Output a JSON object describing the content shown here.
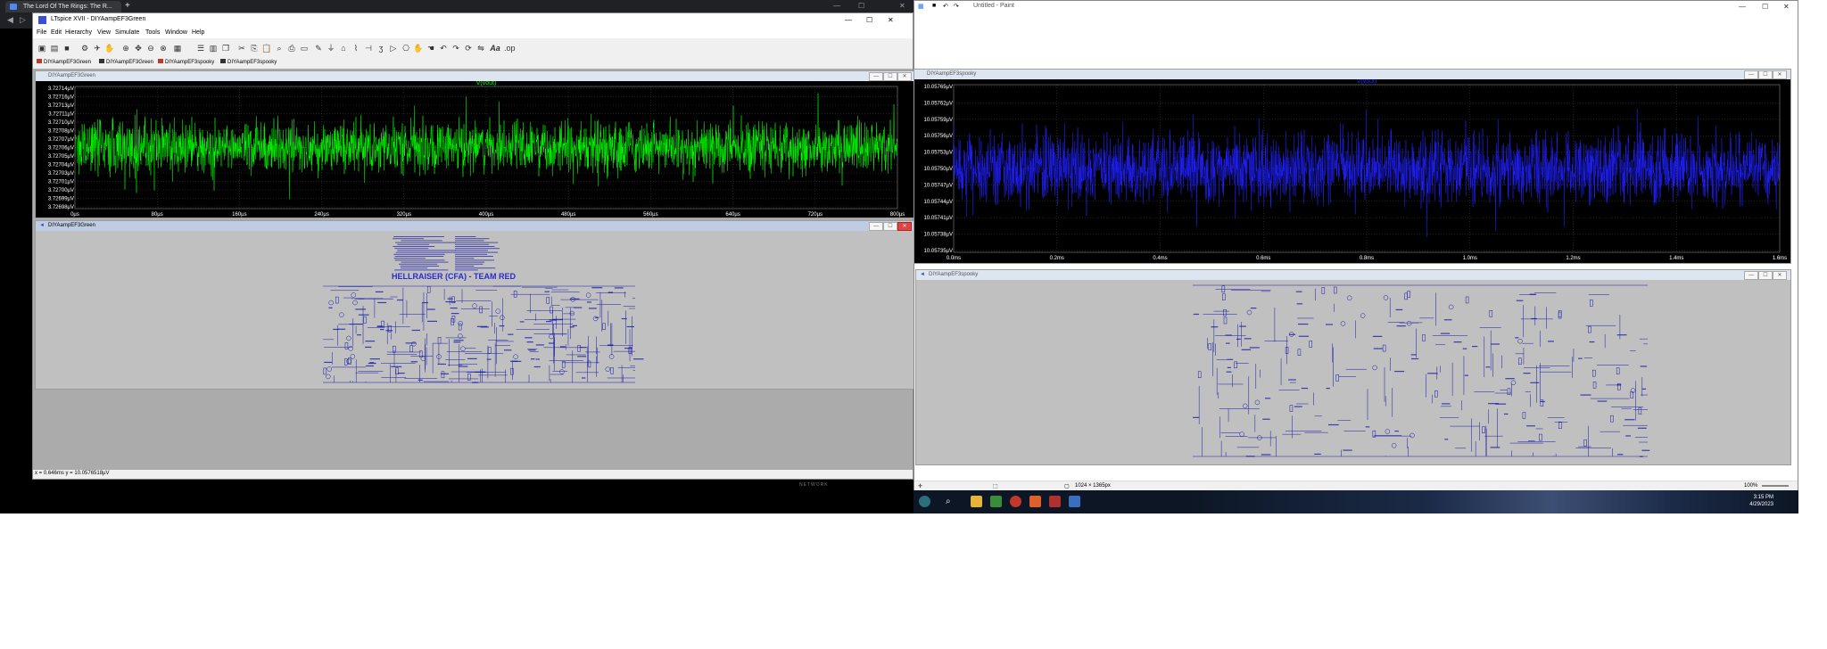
{
  "browser": {
    "tab_title": "The Lord Of The Rings: The R...",
    "new_tab": "+",
    "min": "—",
    "max": "☐",
    "close": "✕"
  },
  "ltspice": {
    "title": "LTspice XVII - DIYAampEF3Green",
    "menu": [
      "File",
      "Edit",
      "Hierarchy",
      "View",
      "Simulate",
      "Tools",
      "Window",
      "Help"
    ],
    "doc_tabs": [
      "DIYAampEF3Green",
      "DIYAampEF3Green",
      "DIYAampEF3spooky",
      "DIYAampEF3spooky"
    ],
    "status_text": "x = 0.646ms    y = 10.0576518µV",
    "win_min": "—",
    "win_max": "☐",
    "win_close": "✕",
    "windows": {
      "plot_green_title": "DIYAampEF3Green",
      "plot_blue_title": "DIYAampEF3spooky",
      "sch_green_title": "DIYAampEF3Green",
      "sch_blue_title": "DIYAampEF3spooky",
      "sch_green_heading": "HELLRAISER (CFA) - TEAM RED"
    }
  },
  "paint": {
    "title": "Untitled - Paint",
    "canvas_size": "1024 × 1365px",
    "zoom": "100%"
  },
  "taskbar": {
    "time": "3:15 PM",
    "date": "4/29/2023"
  },
  "watermark": "NETWORK",
  "chart_data": [
    {
      "type": "line",
      "title": "V(vout)",
      "x_ticks": [
        "0µs",
        "80µs",
        "160µs",
        "240µs",
        "320µs",
        "400µs",
        "480µs",
        "560µs",
        "640µs",
        "720µs",
        "800µs"
      ],
      "y_ticks": [
        "3.72714µV",
        "3.72716µV",
        "3.72713µV",
        "3.72711µV",
        "3.72710µV",
        "3.72708µV",
        "3.72707µV",
        "3.72706µV",
        "3.72705µV",
        "3.72704µV",
        "3.72703µV",
        "3.72701µV",
        "3.72700µV",
        "3.72699µV",
        "3.72698µV"
      ],
      "xlim": [
        0,
        800
      ],
      "x_unit": "µs",
      "grid": true,
      "series": [
        {
          "name": "V(vout)",
          "color": "#00ff00",
          "description": "dense noise"
        }
      ]
    },
    {
      "type": "line",
      "title": "V(vout)",
      "x_ticks": [
        "0.0ms",
        "0.2ms",
        "0.4ms",
        "0.6ms",
        "0.8ms",
        "1.0ms",
        "1.2ms",
        "1.4ms",
        "1.6ms"
      ],
      "y_ticks": [
        "10.05765µV",
        "10.05762µV",
        "10.05759µV",
        "10.05756µV",
        "10.05753µV",
        "10.05750µV",
        "10.05747µV",
        "10.05744µV",
        "10.05741µV",
        "10.05738µV",
        "10.05735µV"
      ],
      "xlim": [
        0,
        1.6
      ],
      "x_unit": "ms",
      "grid": true,
      "series": [
        {
          "name": "V(vout)",
          "color": "#2222ff",
          "description": "dense noise"
        }
      ]
    }
  ],
  "colors": {
    "trace_green": "#00ff00",
    "trace_blue": "#2020ff",
    "schematic_wire": "#1a1aa8",
    "schematic_red_text": "#2a2ad0"
  }
}
